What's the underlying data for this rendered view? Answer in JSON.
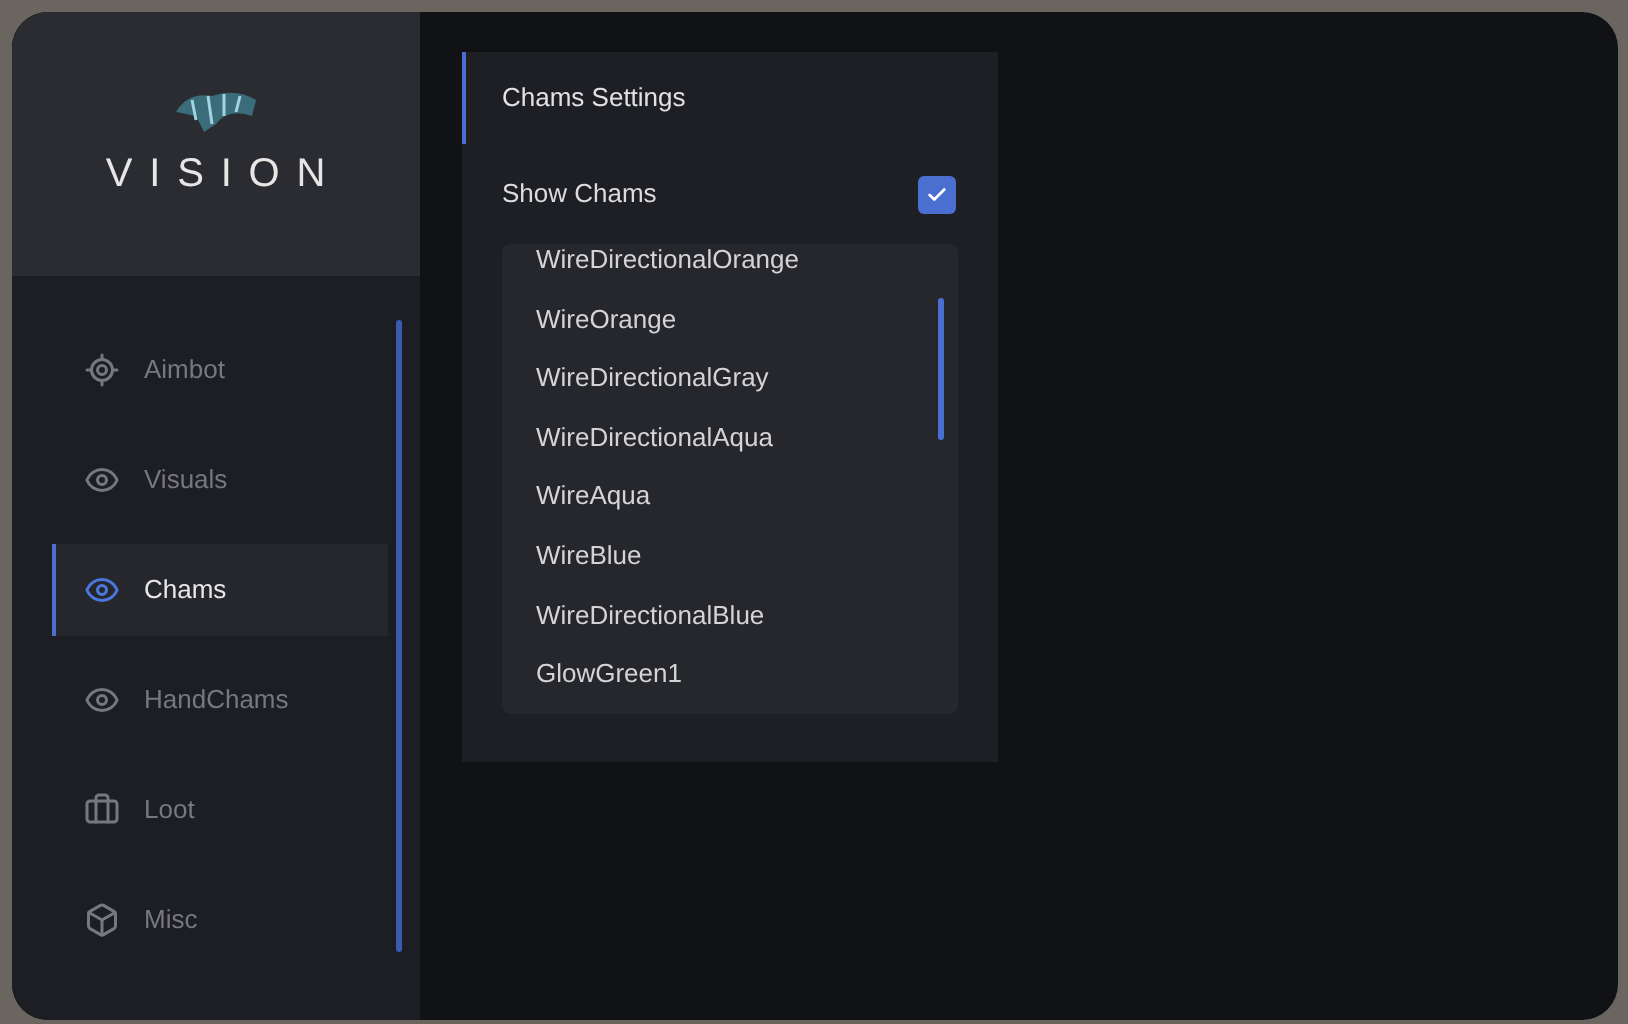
{
  "logo": {
    "text": "VISION"
  },
  "sidebar": {
    "items": [
      {
        "label": "Aimbot",
        "selected": false
      },
      {
        "label": "Visuals",
        "selected": false
      },
      {
        "label": "Chams",
        "selected": true
      },
      {
        "label": "HandChams",
        "selected": false
      },
      {
        "label": "Loot",
        "selected": false
      },
      {
        "label": "Misc",
        "selected": false
      }
    ]
  },
  "panel": {
    "title": "Chams Settings",
    "show_chams": {
      "label": "Show Chams",
      "checked": true
    },
    "materials": [
      "WireDirectionalOrange",
      "WireOrange",
      "WireDirectionalGray",
      "WireDirectionalAqua",
      "WireAqua",
      "WireBlue",
      "WireDirectionalBlue",
      "GlowGreen1"
    ]
  }
}
